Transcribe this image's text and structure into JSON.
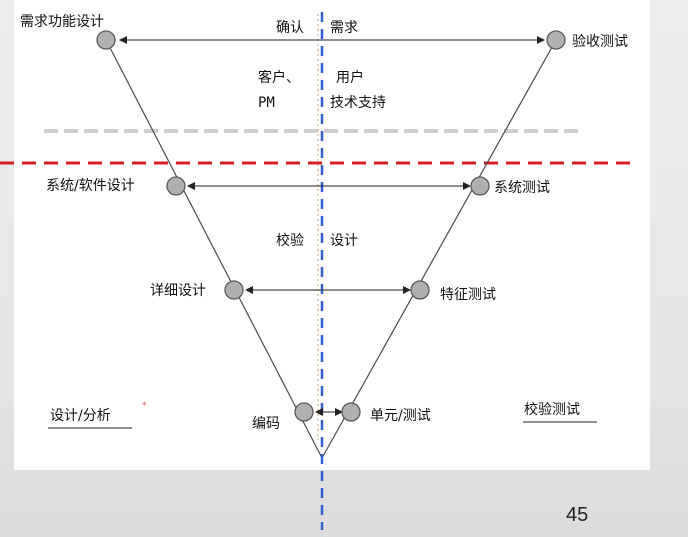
{
  "node_labels": {
    "requirements_design": "需求功能设计",
    "acceptance_test": "验收测试",
    "system_design": "系统/软件设计",
    "system_test": "系统测试",
    "detailed_design": "详细设计",
    "feature_test": "特征测试",
    "coding": "编码",
    "unit_test": "单元/测试"
  },
  "center_labels": {
    "confirm": "确认",
    "requirements": "需求",
    "customer": "客户、",
    "pm": "PM",
    "user": "用户",
    "tech_support": "技术支持",
    "verify": "校验",
    "design": "设计"
  },
  "side_labels": {
    "left": "设计/分析",
    "right": "校验测试"
  },
  "stray_mark": "*",
  "page_number": "45",
  "colors": {
    "node_fill": "#b0b0b0",
    "node_stroke": "#5a5a5a",
    "red_dash": "#d42020",
    "blue_dash": "#2f5fd0",
    "gray_dash": "#c8c8c8",
    "line": "#4a4a4a"
  }
}
